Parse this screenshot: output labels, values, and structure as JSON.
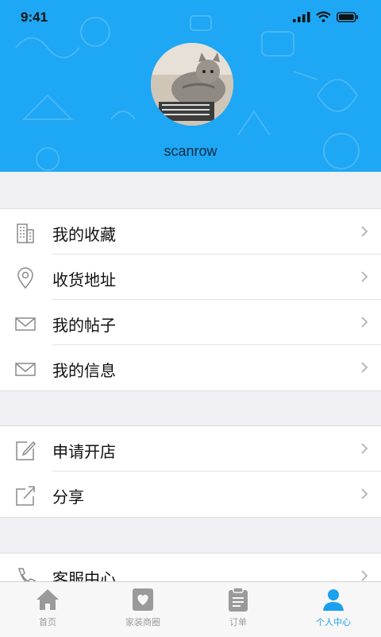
{
  "status_bar": {
    "time": "9:41"
  },
  "profile": {
    "username": "scanrow"
  },
  "menu_group_1": [
    {
      "label": "我的收藏",
      "icon": "building-icon"
    },
    {
      "label": "收货地址",
      "icon": "location-pin-icon"
    },
    {
      "label": "我的帖子",
      "icon": "envelope-icon"
    },
    {
      "label": "我的信息",
      "icon": "envelope-icon"
    }
  ],
  "menu_group_2": [
    {
      "label": "申请开店",
      "icon": "edit-icon"
    },
    {
      "label": "分享",
      "icon": "share-icon"
    }
  ],
  "menu_group_3": [
    {
      "label": "客服中心",
      "icon": "phone-icon"
    }
  ],
  "tab_bar": {
    "items": [
      {
        "label": "首页",
        "icon": "home-icon"
      },
      {
        "label": "家装商圈",
        "icon": "heart-card-icon"
      },
      {
        "label": "订单",
        "icon": "clipboard-icon"
      },
      {
        "label": "个人中心",
        "icon": "person-icon"
      }
    ],
    "active_index": 3
  },
  "colors": {
    "header": "#1ea7f4",
    "accent": "#1aa0ef",
    "background": "#efeff4"
  }
}
